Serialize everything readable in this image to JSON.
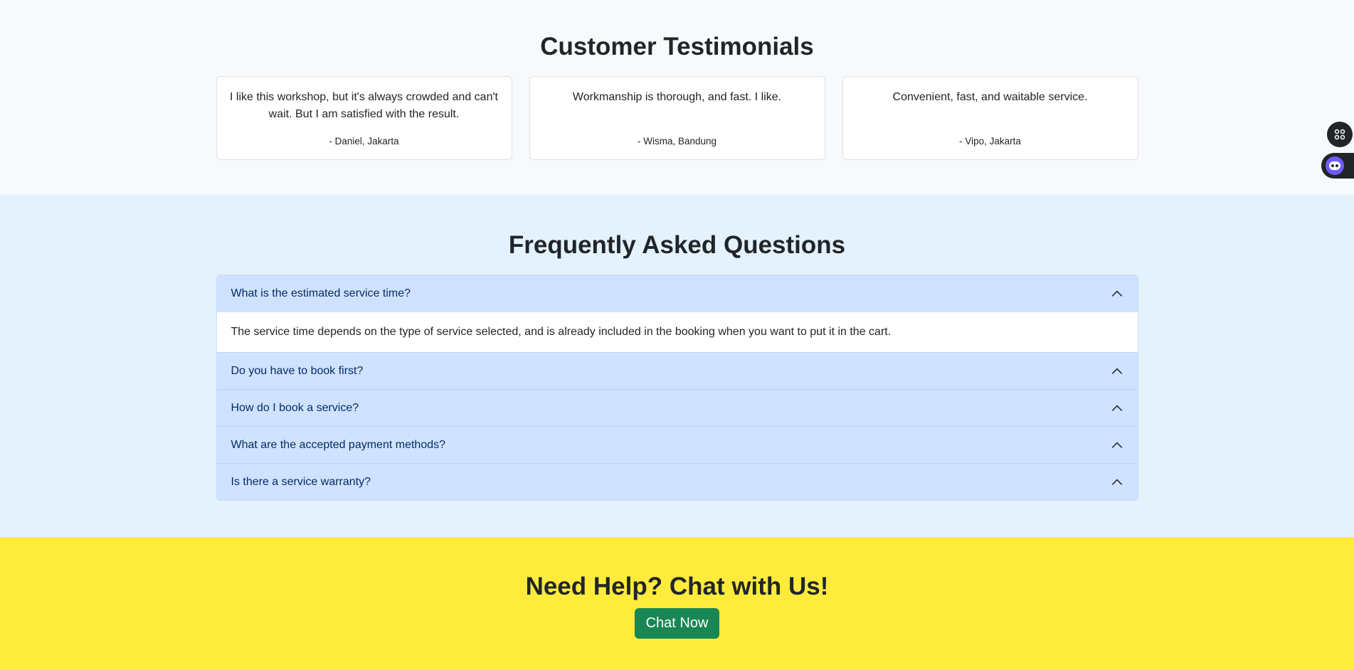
{
  "testimonials": {
    "title": "Customer Testimonials",
    "items": [
      {
        "quote": "I like this workshop, but it's always crowded and can't wait. But I am satisfied with the result.",
        "author": "- Daniel, Jakarta"
      },
      {
        "quote": "Workmanship is thorough, and fast. I like.",
        "author": "- Wisma, Bandung"
      },
      {
        "quote": "Convenient, fast, and waitable service.",
        "author": "- Vipo, Jakarta"
      }
    ]
  },
  "faq": {
    "title": "Frequently Asked Questions",
    "items": [
      {
        "question": "What is the estimated service time?",
        "answer": "The service time depends on the type of service selected, and is already included in the booking when you want to put it in the cart."
      },
      {
        "question": "Do you have to book first?"
      },
      {
        "question": "How do I book a service?"
      },
      {
        "question": "What are the accepted payment methods?"
      },
      {
        "question": "Is there a service warranty?"
      }
    ]
  },
  "help": {
    "title": "Need Help? Chat with Us!",
    "button_label": "Chat Now"
  },
  "colors": {
    "faq_bg": "#e3f2fd",
    "faq_question_bg": "#cfe2ff",
    "help_bg": "#ffeb3b",
    "chat_button": "#198754"
  },
  "icons": {
    "faq_toggle": "chevron-up-icon",
    "floating_widget_1": "command-icon",
    "floating_widget_2": "robot-icon"
  }
}
